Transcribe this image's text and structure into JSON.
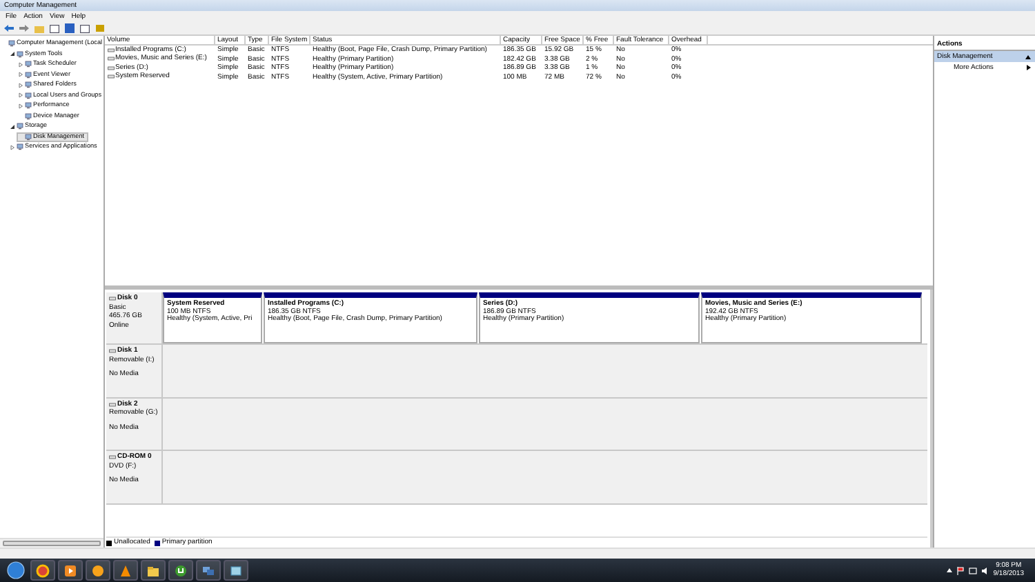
{
  "window": {
    "title": "Computer Management"
  },
  "menu": [
    "File",
    "Action",
    "View",
    "Help"
  ],
  "tree": [
    {
      "label": "Computer Management (Local",
      "selected": false,
      "children": [
        {
          "label": "System Tools",
          "selected": false,
          "expanded": true,
          "children": [
            {
              "label": "Task Scheduler",
              "selected": false,
              "expanded": false
            },
            {
              "label": "Event Viewer",
              "selected": false,
              "expanded": false
            },
            {
              "label": "Shared Folders",
              "selected": false,
              "expanded": false
            },
            {
              "label": "Local Users and Groups",
              "selected": false,
              "expanded": false
            },
            {
              "label": "Performance",
              "selected": false,
              "expanded": false
            },
            {
              "label": "Device Manager",
              "selected": false
            }
          ]
        },
        {
          "label": "Storage",
          "selected": false,
          "expanded": true,
          "children": [
            {
              "label": "Disk Management",
              "selected": true
            }
          ]
        },
        {
          "label": "Services and Applications",
          "selected": false,
          "expanded": false
        }
      ]
    }
  ],
  "table": {
    "columns": [
      "Volume",
      "Layout",
      "Type",
      "File System",
      "Status",
      "Capacity",
      "Free Space",
      "% Free",
      "Fault Tolerance",
      "Overhead"
    ],
    "rows": [
      [
        "Installed Programs (C:)",
        "Simple",
        "Basic",
        "NTFS",
        "Healthy (Boot, Page File, Crash Dump, Primary Partition)",
        "186.35 GB",
        "15.92 GB",
        "15 %",
        "No",
        "0%"
      ],
      [
        "Movies, Music and Series (E:)",
        "Simple",
        "Basic",
        "NTFS",
        "Healthy (Primary Partition)",
        "182.42 GB",
        "3.38 GB",
        "2 %",
        "No",
        "0%"
      ],
      [
        "Series (D:)",
        "Simple",
        "Basic",
        "NTFS",
        "Healthy (Primary Partition)",
        "186.89 GB",
        "3.38 GB",
        "1 %",
        "No",
        "0%"
      ],
      [
        "System Reserved",
        "Simple",
        "Basic",
        "NTFS",
        "Healthy (System, Active, Primary Partition)",
        "100 MB",
        "72 MB",
        "72 %",
        "No",
        "0%"
      ]
    ]
  },
  "disks": [
    {
      "name": "Disk 0",
      "lines": [
        "Basic",
        "465.76 GB",
        "Online"
      ],
      "partitions": [
        {
          "name": "System Reserved",
          "size": "100 MB NTFS",
          "status": "Healthy (System, Active, Pri"
        },
        {
          "name": "Installed Programs  (C:)",
          "size": "186.35 GB NTFS",
          "status": "Healthy (Boot, Page File, Crash Dump, Primary Partition)"
        },
        {
          "name": "Series  (D:)",
          "size": "186.89 GB NTFS",
          "status": "Healthy (Primary Partition)"
        },
        {
          "name": "Movies, Music and Series  (E:)",
          "size": "192.42 GB NTFS",
          "status": "Healthy (Primary Partition)"
        }
      ]
    },
    {
      "name": "Disk 1",
      "lines": [
        "Removable (I:)",
        "No Media"
      ]
    },
    {
      "name": "Disk 2",
      "lines": [
        "Removable (G:)",
        "No Media"
      ]
    },
    {
      "name": "CD-ROM 0",
      "lines": [
        "DVD (F:)",
        "No Media"
      ]
    }
  ],
  "legend": [
    {
      "label": "Unallocated",
      "color": "#000000"
    },
    {
      "label": "Primary partition",
      "color": "#000080"
    }
  ],
  "actions": {
    "title": "Actions",
    "groups": [
      {
        "label": "Disk Management",
        "selected": true,
        "items": [
          "More Actions"
        ]
      }
    ]
  },
  "clock": {
    "time": "9:08 PM",
    "date": "9/18/2013"
  }
}
